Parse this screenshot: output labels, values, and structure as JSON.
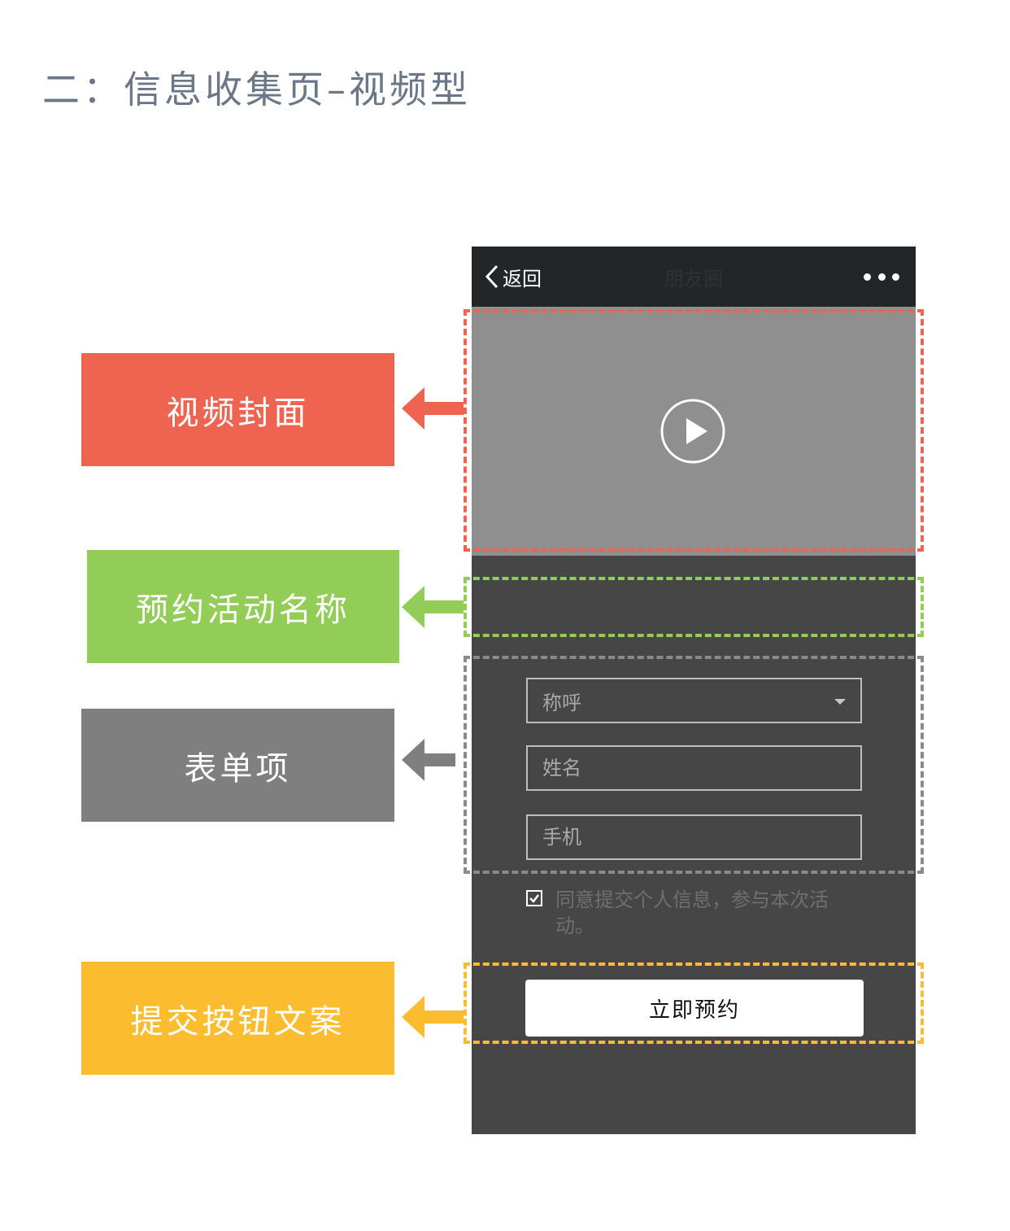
{
  "page": {
    "title": "二：信息收集页–视频型"
  },
  "annotations": {
    "video_cover": "视频封面",
    "activity_name": "预约活动名称",
    "form_items": "表单项",
    "submit_copy": "提交按钮文案"
  },
  "colors": {
    "video_cover": "#ee6451",
    "activity_name": "#92cd57",
    "form_items": "#7f7f7f",
    "submit_copy": "#fbbd2f"
  },
  "phone": {
    "navbar": {
      "back_label": "返回",
      "title": "朋友圈",
      "more_icon": "more-dots-icon"
    },
    "video": {
      "play_icon": "play-icon"
    },
    "form": {
      "title_select": "称呼",
      "name_placeholder": "姓名",
      "phone_placeholder": "手机"
    },
    "agree": {
      "checked": true,
      "text": "同意提交个人信息，参与本次活动。"
    },
    "submit_label": "立即预约"
  }
}
